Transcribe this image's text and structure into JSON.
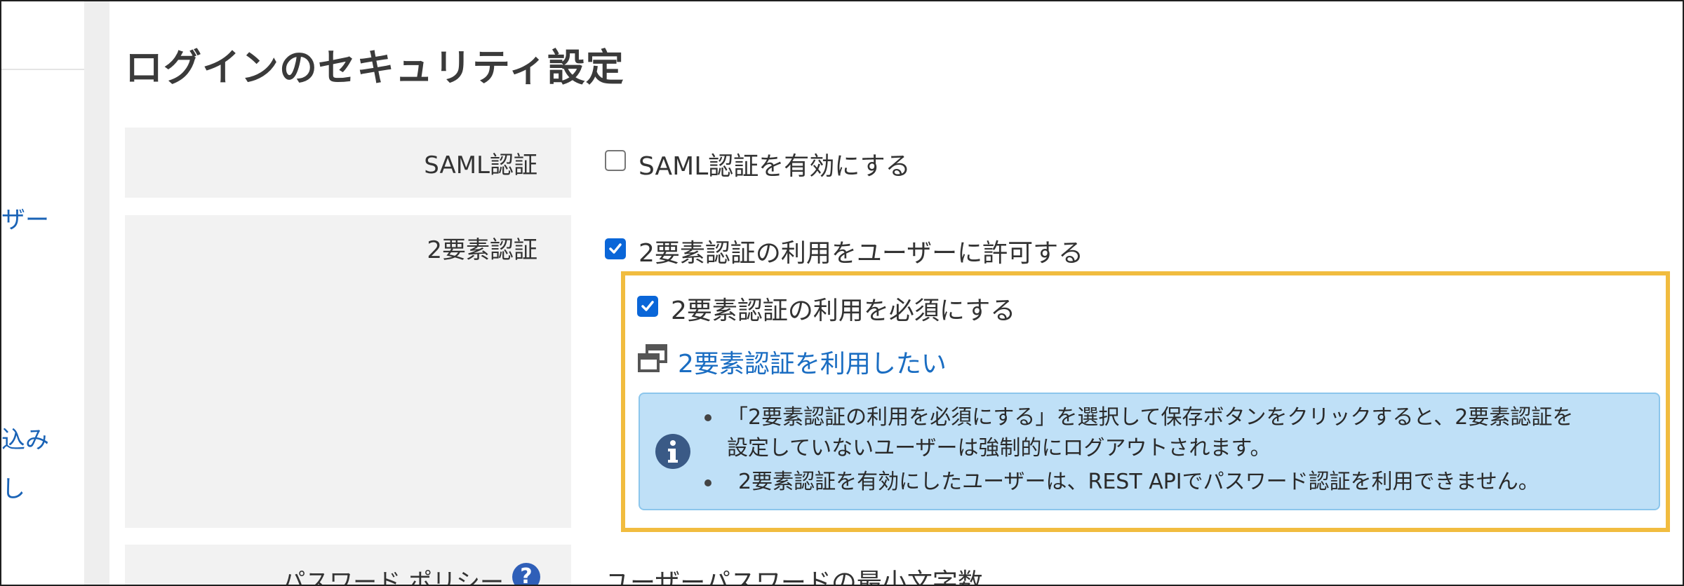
{
  "page": {
    "title": "ログインのセキュリティ設定"
  },
  "sidebar": {
    "fragments": [
      "ザー",
      "込み",
      "し"
    ]
  },
  "rows": {
    "saml": {
      "label": "SAML認証",
      "checkbox_label": "SAML認証を有効にする",
      "checked": false
    },
    "two_factor": {
      "label": "2要素認証",
      "allow_label": "2要素認証の利用をユーザーに許可する",
      "allow_checked": true,
      "require_label": "2要素認証の利用を必須にする",
      "require_checked": true,
      "link_label": "2要素認証を利用したい",
      "info": {
        "bullet1_line1": "「2要素認証の利用を必須にする」を選択して保存ボタンをクリックすると、2要素認証を",
        "bullet1_line2": "設定していないユーザーは強制的にログアウトされます。",
        "bullet2": "2要素認証を有効にしたユーザーは、REST APIでパスワード認証を利用できません。"
      }
    },
    "password_policy": {
      "label": "パスワード ポリシー",
      "help_glyph": "?",
      "field_label": "ユーザーパスワードの最小文字数"
    }
  },
  "colors": {
    "accent": "#0a66d8",
    "highlight_border": "#f1bc3f",
    "info_bg": "#bfe0f7",
    "link": "#1a6dc2"
  },
  "icons": [
    "check-icon",
    "new-window-icon",
    "info-icon",
    "help-icon"
  ]
}
